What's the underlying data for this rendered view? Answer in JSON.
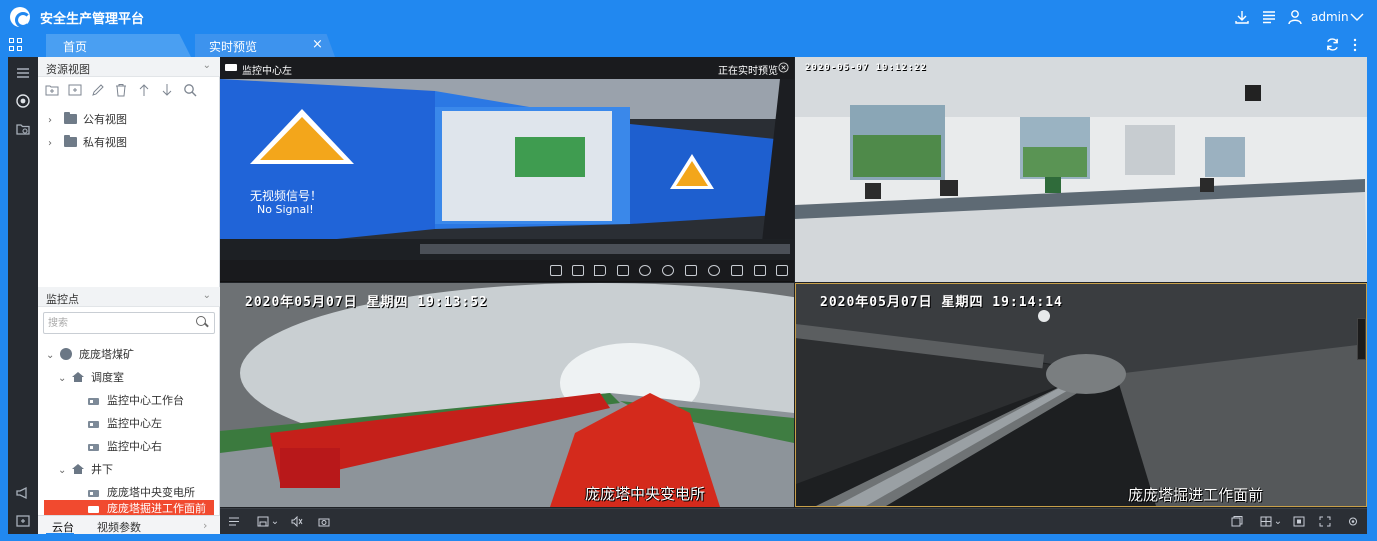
{
  "app": {
    "title": "安全生产管理平台",
    "user": "admin"
  },
  "tabs": [
    {
      "label": "首页"
    },
    {
      "label": "实时预览",
      "close": "×"
    }
  ],
  "left_panel": {
    "resource_view": {
      "header": "资源视图",
      "tree": [
        {
          "label": "公有视图"
        },
        {
          "label": "私有视图"
        }
      ]
    },
    "monitor_points": {
      "header": "监控点",
      "search_placeholder": "搜索",
      "tree": {
        "root": "庞庞塔煤矿",
        "group1": "调度室",
        "group1_items": [
          "监控中心工作台",
          "监控中心左",
          "监控中心右"
        ],
        "group2": "井下",
        "group2_items": [
          "庞庞塔中央变电所",
          "庞庞塔掘进工作面前"
        ]
      }
    },
    "bottom_tabs": [
      "云台",
      "视频参数"
    ]
  },
  "video": {
    "cell1": {
      "title": "监控中心左",
      "status": "正在实时预览",
      "screen_text_cn": "无视频信号！",
      "screen_text_en": "No Signal!"
    },
    "cell2": {
      "osd": "2020-05-07 19:12:22"
    },
    "cell3": {
      "osd": "2020年05月07日 星期四 19:13:52",
      "caption": "庞庞塔中央变电所"
    },
    "cell4": {
      "osd": "2020年05月07日 星期四 19:14:14",
      "caption": "庞庞塔掘进工作面前"
    }
  },
  "colors": {
    "brand": "#2188f0",
    "selected": "#f14a2f",
    "active_cell_border": "#c8a04a"
  }
}
